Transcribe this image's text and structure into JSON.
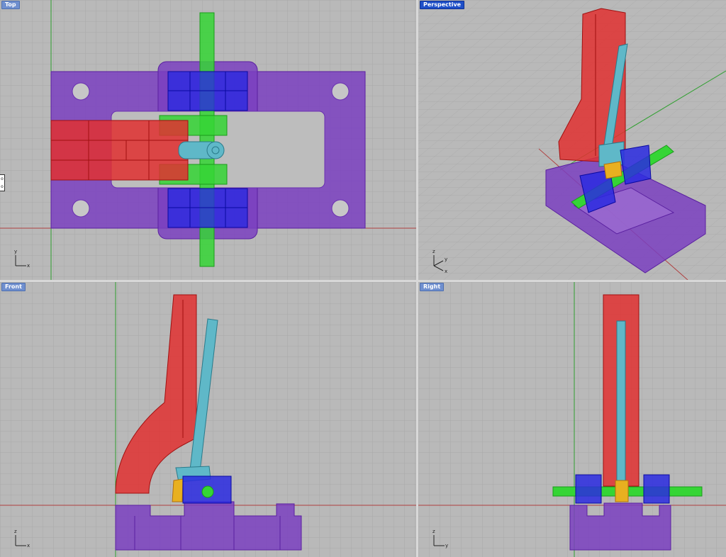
{
  "viewports": {
    "top": {
      "title": "Top",
      "active": false,
      "axis_a": "y",
      "axis_b": "x"
    },
    "perspective": {
      "title": "Perspective",
      "active": true,
      "axis_a": "z",
      "axis_b": "y",
      "axis_c": "x"
    },
    "front": {
      "title": "Front",
      "active": false,
      "axis_a": "z",
      "axis_b": "x"
    },
    "right": {
      "title": "Right",
      "active": false,
      "axis_a": "z",
      "axis_b": "y"
    }
  },
  "side_panel": {
    "glyphs": "o\no"
  },
  "colors": {
    "viewport_bg": "#b9b9b9",
    "grid": "#a8a8a8",
    "base": "#7a3fc0",
    "red_part": "#e03030",
    "blue_part": "#2a2ae0",
    "green_part": "#35d535",
    "cyan_part": "#5fb8c8",
    "yellow_part": "#e8b020",
    "x_axis": "#b04040",
    "y_axis": "#30a030"
  }
}
